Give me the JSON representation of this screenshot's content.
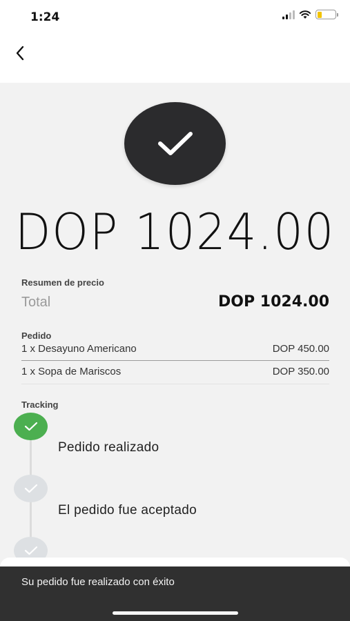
{
  "status_bar": {
    "time": "1:24",
    "icons": [
      "signal-icon",
      "wifi-icon",
      "battery-icon"
    ]
  },
  "nav": {
    "back_icon": "chevron-left-icon"
  },
  "hero": {
    "icon": "check-icon",
    "amount": "DOP 1024.00"
  },
  "price_summary": {
    "section_label": "Resumen de precio",
    "total_label": "Total",
    "total_value": "DOP 1024.00"
  },
  "order": {
    "section_label": "Pedido",
    "items": [
      {
        "name": "1 x Desayuno Americano",
        "price": "DOP 450.00"
      },
      {
        "name": "1 x Sopa de Mariscos",
        "price": "DOP 350.00"
      }
    ]
  },
  "tracking": {
    "section_label": "Tracking",
    "steps": [
      {
        "label": "Pedido realizado",
        "status": "done"
      },
      {
        "label": "El pedido fue aceptado",
        "status": "pending"
      },
      {
        "label": "",
        "status": "pending"
      }
    ]
  },
  "toast": {
    "message": "Su pedido fue realizado con éxito"
  },
  "colors": {
    "success": "#4caf50",
    "dark": "#2b2b2d",
    "pending": "#dde0e3",
    "toast_bg": "#303030"
  }
}
